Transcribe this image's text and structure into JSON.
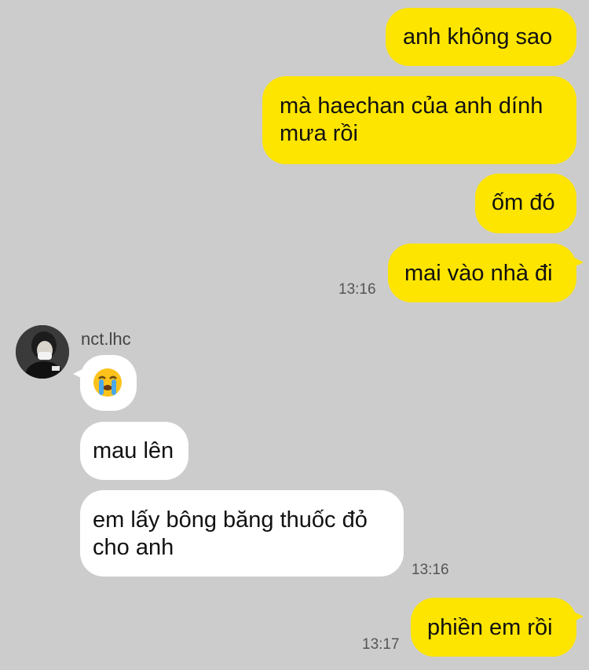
{
  "messages": [
    {
      "dir": "out",
      "text": "anh không sao"
    },
    {
      "dir": "out",
      "lines": [
        "mà haechan của anh dính",
        "mưa rồi"
      ]
    },
    {
      "dir": "out",
      "text": "ốm đó"
    },
    {
      "dir": "out",
      "text": "mai vào nhà đi",
      "time": "13:16"
    },
    {
      "dir": "in",
      "sender": "nct.lhc",
      "emoji": "loudly-crying-face"
    },
    {
      "dir": "in",
      "text": "mau lên"
    },
    {
      "dir": "in",
      "lines": [
        "em lấy bông băng thuốc đỏ",
        "cho anh"
      ],
      "time": "13:16"
    },
    {
      "dir": "out",
      "text": "phiền em rồi",
      "time": "13:17"
    }
  ],
  "colors": {
    "background": "#cccccc",
    "outgoing": "#fee500",
    "incoming": "#ffffff"
  }
}
